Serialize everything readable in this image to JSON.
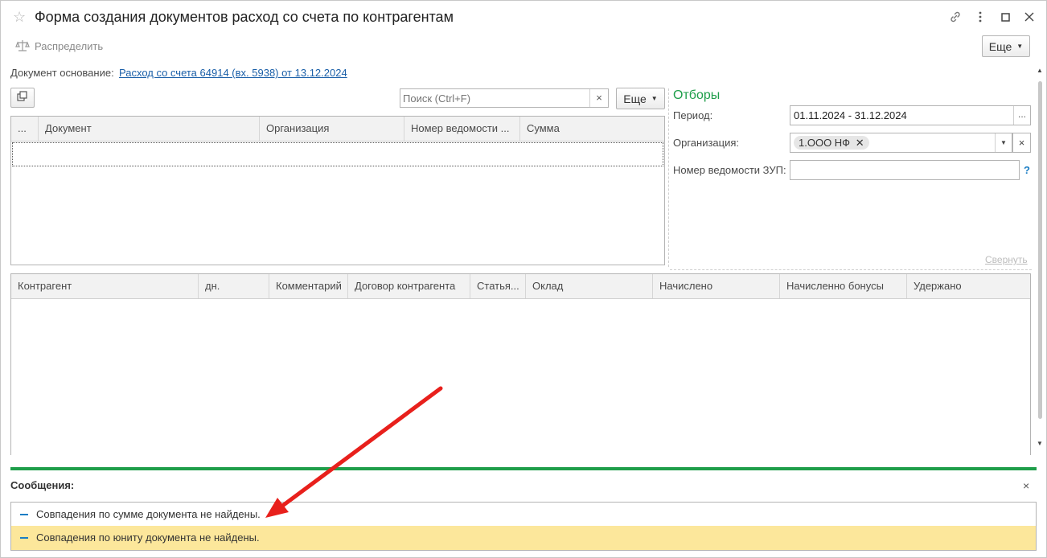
{
  "window": {
    "title": "Форма создания документов расход со счета по контрагентам",
    "link_icon": "link-icon",
    "more_icon": "more-vertical-icon",
    "maximize_icon": "maximize-icon",
    "close_icon": "close-icon"
  },
  "toolbar": {
    "distribute_label": "Распределить",
    "more_label": "Еще"
  },
  "basis": {
    "label": "Документ основание:",
    "link_text": "Расход со счета 64914 (вх. 5938) от 13.12.2024"
  },
  "top_grid": {
    "search_placeholder": "Поиск (Ctrl+F)",
    "search_clear": "×",
    "more_label": "Еще",
    "columns": [
      "...",
      "Документ",
      "Организация",
      "Номер ведомости ...",
      "Сумма"
    ]
  },
  "filters": {
    "title": "Отборы",
    "period_label": "Период:",
    "period_value": "01.11.2024 - 31.12.2024",
    "period_button": "...",
    "org_label": "Организация:",
    "org_tag": "1.ООО НФ",
    "org_clear": "×",
    "zup_label": "Номер ведомости ЗУП:",
    "zup_value": "",
    "help": "?",
    "collapse_link": "Свернуть"
  },
  "bottom_grid": {
    "columns": [
      "Контрагент",
      "дн.",
      "Комментарий",
      "Договор контрагента",
      "Статья...",
      "Оклад",
      "Начислено",
      "Начисленно бонусы",
      "Удержано"
    ]
  },
  "messages": {
    "title": "Сообщения:",
    "close": "×",
    "items": [
      "Совпадения по сумме документа не найдены.",
      "Совпадения по юниту документа не найдены."
    ]
  },
  "colors": {
    "accent_green": "#1e9e4a",
    "link_blue": "#1a5fa8",
    "highlight_yellow": "#fce79b",
    "arrow_red": "#e8201c"
  }
}
